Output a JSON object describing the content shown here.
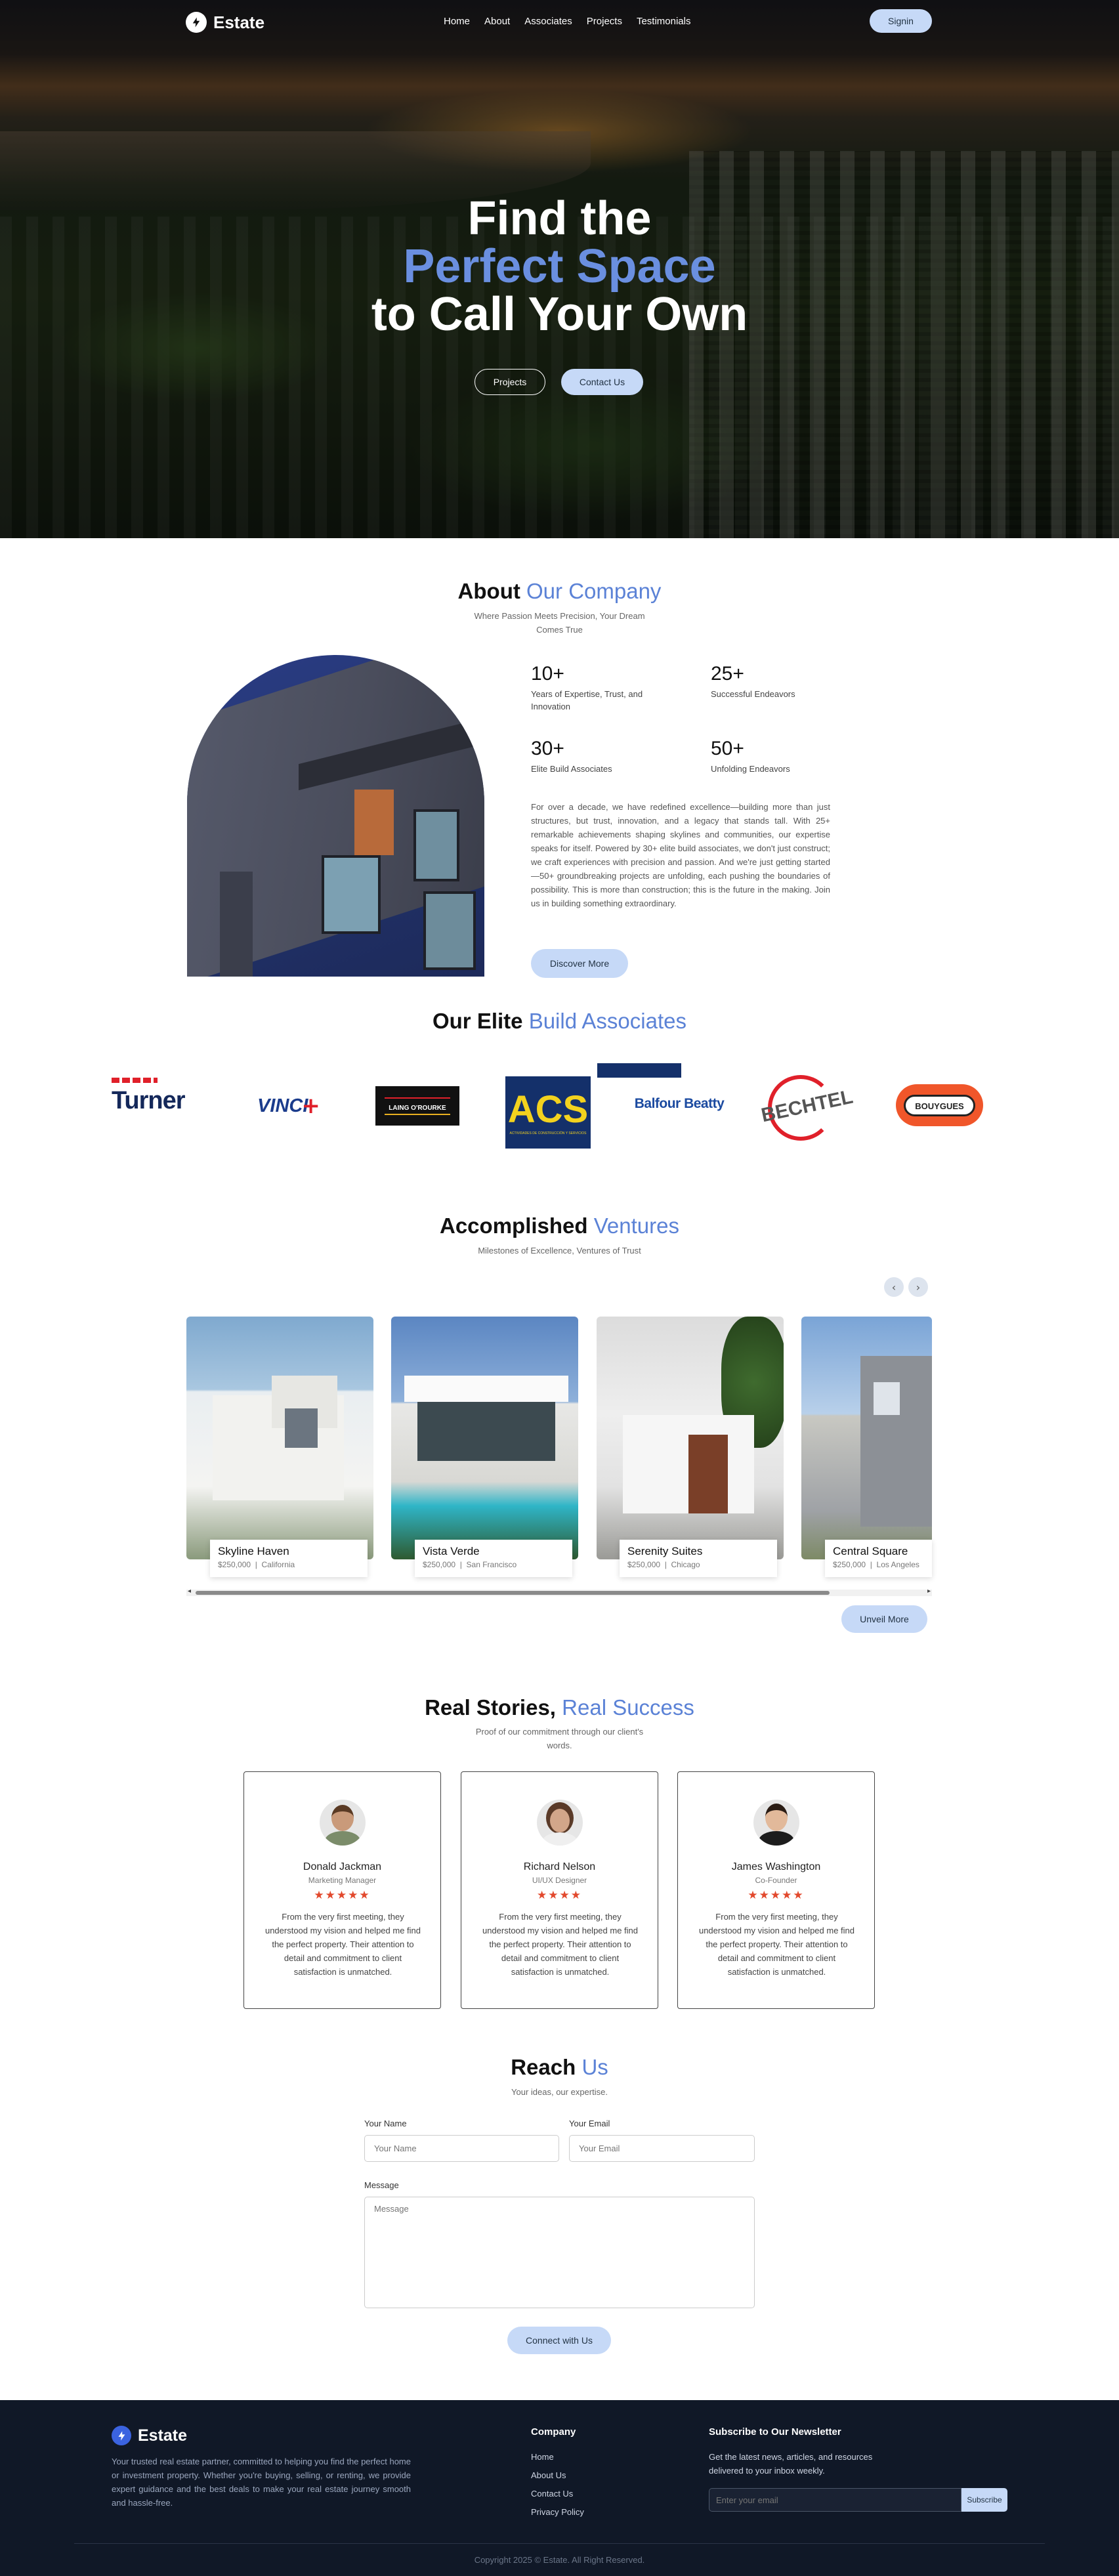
{
  "brand": {
    "name": "Estate",
    "accent": "#5b82d6",
    "button_bg": "#c6d9f7"
  },
  "nav": {
    "links": [
      "Home",
      "About",
      "Associates",
      "Projects",
      "Testimonials"
    ],
    "signin": "Signin"
  },
  "hero": {
    "line1": "Find the",
    "line2": "Perfect Space",
    "line3": "to Call Your Own",
    "btn_projects": "Projects",
    "btn_contact": "Contact Us"
  },
  "about": {
    "title_bold": "About",
    "title_accent": "Our Company",
    "subtitle_line1": "Where Passion Meets Precision, Your Dream",
    "subtitle_line2": "Comes True",
    "stats": [
      {
        "value": "10+",
        "label_line1": "Years of Expertise, Trust, and",
        "label_line2": "Innovation"
      },
      {
        "value": "25+",
        "label_line1": "Successful Endeavors",
        "label_line2": ""
      },
      {
        "value": "30+",
        "label_line1": "Elite Build Associates",
        "label_line2": ""
      },
      {
        "value": "50+",
        "label_line1": "Unfolding Endeavors",
        "label_line2": ""
      }
    ],
    "paragraph": "For over a decade, we have redefined excellence—building more than just structures, but trust, innovation, and a legacy that stands tall. With 25+ remarkable achievements shaping skylines and communities, our expertise speaks for itself. Powered by 30+ elite build associates, we don't just construct; we craft experiences with precision and passion. And we're just getting started—50+ groundbreaking projects are unfolding, each pushing the boundaries of possibility. This is more than construction; this is the future in the making. Join us in building something extraordinary.",
    "button": "Discover More"
  },
  "associates": {
    "title_bold": "Our Elite",
    "title_accent": "Build Associates",
    "logos": [
      "Turner",
      "VINCI",
      "LAING O'ROURKE",
      "ACS",
      "Balfour Beatty",
      "BECHTEL",
      "BOUYGUES"
    ],
    "acs_sub": "ACTIVIDADES DE CONSTRUCCIÓN Y SERVICIOS"
  },
  "projects": {
    "title_bold": "Accomplished",
    "title_accent": "Ventures",
    "subtitle": "Milestones of Excellence, Ventures of Trust",
    "prev_icon": "‹",
    "next_icon": "›",
    "items": [
      {
        "name": "Skyline Haven",
        "price": "$250,000",
        "location": "California"
      },
      {
        "name": "Vista Verde",
        "price": "$250,000",
        "location": "San Francisco"
      },
      {
        "name": "Serenity Suites",
        "price": "$250,000",
        "location": "Chicago"
      },
      {
        "name": "Central Square",
        "price": "$250,000",
        "location": "Los Angeles"
      }
    ],
    "button": "Unveil More"
  },
  "testimonials": {
    "title_bold": "Real Stories,",
    "title_accent": "Real Success",
    "subtitle_line1": "Proof of our commitment through our client's",
    "subtitle_line2": "words.",
    "items": [
      {
        "name": "Donald Jackman",
        "role": "Marketing Manager",
        "stars": "★★★★★",
        "text": "From the very first meeting, they understood my vision and helped me find the perfect property. Their attention to detail and commitment to client satisfaction is unmatched."
      },
      {
        "name": "Richard Nelson",
        "role": "UI/UX Designer",
        "stars": "★★★★",
        "text": "From the very first meeting, they understood my vision and helped me find the perfect property. Their attention to detail and commitment to client satisfaction is unmatched."
      },
      {
        "name": "James Washington",
        "role": "Co-Founder",
        "stars": "★★★★★",
        "text": "From the very first meeting, they understood my vision and helped me find the perfect property. Their attention to detail and commitment to client satisfaction is unmatched."
      }
    ]
  },
  "contact": {
    "title_bold": "Reach",
    "title_accent": "Us",
    "subtitle": "Your ideas, our expertise.",
    "name_label": "Your Name",
    "name_placeholder": "Your Name",
    "email_label": "Your Email",
    "email_placeholder": "Your Email",
    "message_label": "Message",
    "message_placeholder": "Message",
    "button": "Connect with Us"
  },
  "footer": {
    "brand_text": "Your trusted real estate partner, committed to helping you find the perfect home or investment property. Whether you're buying, selling, or renting, we provide expert guidance and the best deals to make your real estate journey smooth and hassle-free.",
    "company_title": "Company",
    "company_links": [
      "Home",
      "About Us",
      "Contact Us",
      "Privacy Policy"
    ],
    "newsletter_title": "Subscribe to Our Newsletter",
    "newsletter_text_line1": "Get the latest news, articles, and resources",
    "newsletter_text_line2": "delivered to your inbox weekly.",
    "email_placeholder": "Enter your email",
    "subscribe": "Subscribe",
    "copyright": "Copyright 2025 © Estate. All Right Reserved."
  }
}
